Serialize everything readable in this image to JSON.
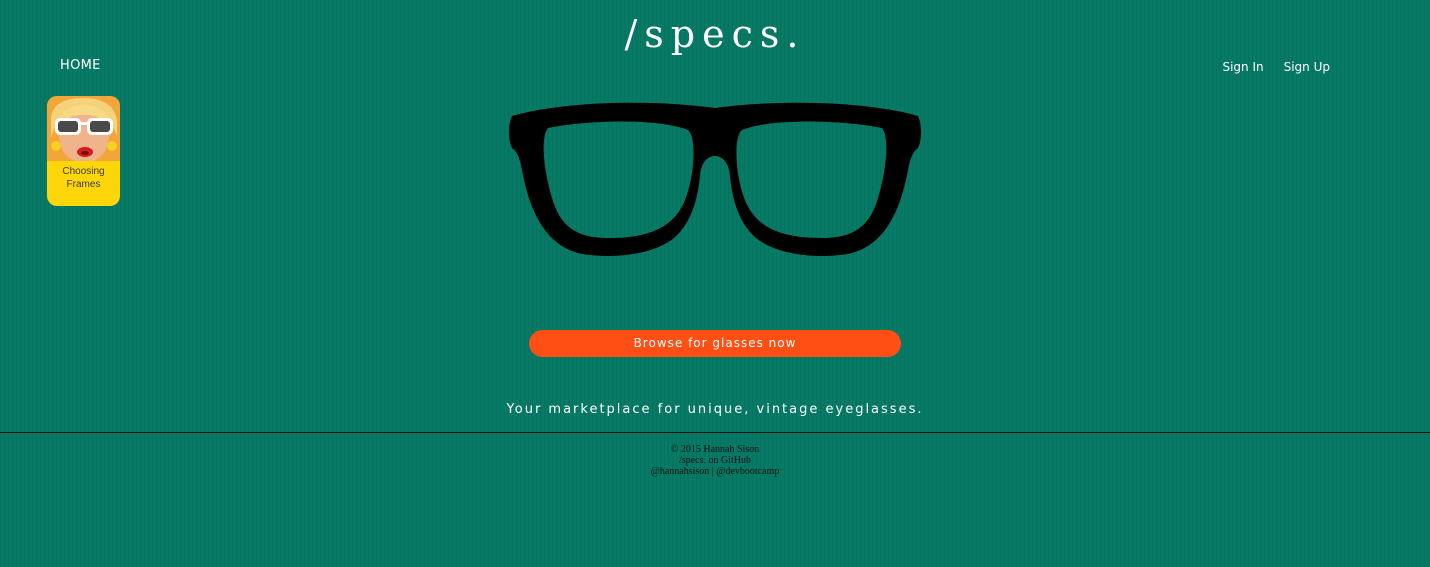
{
  "header": {
    "site_title": "/specs.",
    "home_label": "HOME",
    "sign_in_label": "Sign In",
    "sign_up_label": "Sign Up"
  },
  "sidebar": {
    "card": {
      "label": "Choosing Frames"
    }
  },
  "main": {
    "browse_button_label": "Browse for glasses now",
    "tagline": "Your marketplace for unique, vintage eyeglasses."
  },
  "footer": {
    "copyright": "© 2015 Hannah Sison",
    "github_link": "/specs. on GitHub",
    "twitter_handle": "@hannahsison",
    "separator": " | ",
    "bootcamp_handle": "@devbootcamp"
  },
  "colors": {
    "background": "#077a66",
    "button": "#ff4f14",
    "card": "#ffd609",
    "text_light": "#ffffff",
    "text_dark": "#111111"
  },
  "icons": {
    "hero": "eyeglasses-illustration",
    "card": "woman-sunglasses-photo"
  }
}
